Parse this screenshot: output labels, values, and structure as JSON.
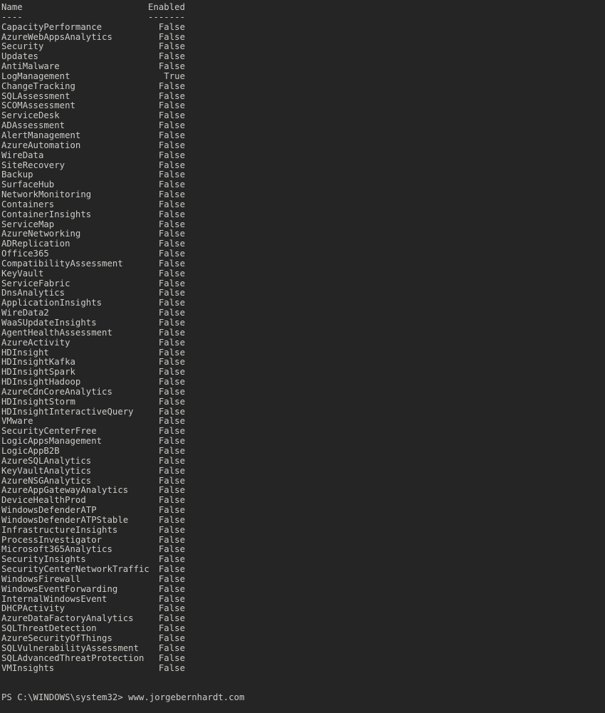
{
  "terminal": {
    "app": "Windows PowerShell",
    "background_color": "#252526",
    "text_color": "#ccccc7",
    "header": {
      "name_label": "Name",
      "enabled_label": "Enabled",
      "name_rule": "----",
      "enabled_rule": "-------"
    },
    "rows": [
      {
        "name": "CapacityPerformance",
        "enabled": "False"
      },
      {
        "name": "AzureWebAppsAnalytics",
        "enabled": "False"
      },
      {
        "name": "Security",
        "enabled": "False"
      },
      {
        "name": "Updates",
        "enabled": "False"
      },
      {
        "name": "AntiMalware",
        "enabled": "False"
      },
      {
        "name": "LogManagement",
        "enabled": "True"
      },
      {
        "name": "ChangeTracking",
        "enabled": "False"
      },
      {
        "name": "SQLAssessment",
        "enabled": "False"
      },
      {
        "name": "SCOMAssessment",
        "enabled": "False"
      },
      {
        "name": "ServiceDesk",
        "enabled": "False"
      },
      {
        "name": "ADAssessment",
        "enabled": "False"
      },
      {
        "name": "AlertManagement",
        "enabled": "False"
      },
      {
        "name": "AzureAutomation",
        "enabled": "False"
      },
      {
        "name": "WireData",
        "enabled": "False"
      },
      {
        "name": "SiteRecovery",
        "enabled": "False"
      },
      {
        "name": "Backup",
        "enabled": "False"
      },
      {
        "name": "SurfaceHub",
        "enabled": "False"
      },
      {
        "name": "NetworkMonitoring",
        "enabled": "False"
      },
      {
        "name": "Containers",
        "enabled": "False"
      },
      {
        "name": "ContainerInsights",
        "enabled": "False"
      },
      {
        "name": "ServiceMap",
        "enabled": "False"
      },
      {
        "name": "AzureNetworking",
        "enabled": "False"
      },
      {
        "name": "ADReplication",
        "enabled": "False"
      },
      {
        "name": "Office365",
        "enabled": "False"
      },
      {
        "name": "CompatibilityAssessment",
        "enabled": "False"
      },
      {
        "name": "KeyVault",
        "enabled": "False"
      },
      {
        "name": "ServiceFabric",
        "enabled": "False"
      },
      {
        "name": "DnsAnalytics",
        "enabled": "False"
      },
      {
        "name": "ApplicationInsights",
        "enabled": "False"
      },
      {
        "name": "WireData2",
        "enabled": "False"
      },
      {
        "name": "WaaSUpdateInsights",
        "enabled": "False"
      },
      {
        "name": "AgentHealthAssessment",
        "enabled": "False"
      },
      {
        "name": "AzureActivity",
        "enabled": "False"
      },
      {
        "name": "HDInsight",
        "enabled": "False"
      },
      {
        "name": "HDInsightKafka",
        "enabled": "False"
      },
      {
        "name": "HDInsightSpark",
        "enabled": "False"
      },
      {
        "name": "HDInsightHadoop",
        "enabled": "False"
      },
      {
        "name": "AzureCdnCoreAnalytics",
        "enabled": "False"
      },
      {
        "name": "HDInsightStorm",
        "enabled": "False"
      },
      {
        "name": "HDInsightInteractiveQuery",
        "enabled": "False"
      },
      {
        "name": "VMware",
        "enabled": "False"
      },
      {
        "name": "SecurityCenterFree",
        "enabled": "False"
      },
      {
        "name": "LogicAppsManagement",
        "enabled": "False"
      },
      {
        "name": "LogicAppB2B",
        "enabled": "False"
      },
      {
        "name": "AzureSQLAnalytics",
        "enabled": "False"
      },
      {
        "name": "KeyVaultAnalytics",
        "enabled": "False"
      },
      {
        "name": "AzureNSGAnalytics",
        "enabled": "False"
      },
      {
        "name": "AzureAppGatewayAnalytics",
        "enabled": "False"
      },
      {
        "name": "DeviceHealthProd",
        "enabled": "False"
      },
      {
        "name": "WindowsDefenderATP",
        "enabled": "False"
      },
      {
        "name": "WindowsDefenderATPStable",
        "enabled": "False"
      },
      {
        "name": "InfrastructureInsights",
        "enabled": "False"
      },
      {
        "name": "ProcessInvestigator",
        "enabled": "False"
      },
      {
        "name": "Microsoft365Analytics",
        "enabled": "False"
      },
      {
        "name": "SecurityInsights",
        "enabled": "False"
      },
      {
        "name": "SecurityCenterNetworkTraffic",
        "enabled": "False"
      },
      {
        "name": "WindowsFirewall",
        "enabled": "False"
      },
      {
        "name": "WindowsEventForwarding",
        "enabled": "False"
      },
      {
        "name": "InternalWindowsEvent",
        "enabled": "False"
      },
      {
        "name": "DHCPActivity",
        "enabled": "False"
      },
      {
        "name": "AzureDataFactoryAnalytics",
        "enabled": "False"
      },
      {
        "name": "SQLThreatDetection",
        "enabled": "False"
      },
      {
        "name": "AzureSecurityOfThings",
        "enabled": "False"
      },
      {
        "name": "SQLVulnerabilityAssessment",
        "enabled": "False"
      },
      {
        "name": "SQLAdvancedThreatProtection",
        "enabled": "False"
      },
      {
        "name": "VMInsights",
        "enabled": "False"
      }
    ],
    "prompt": {
      "path": "PS C:\\WINDOWS\\system32>",
      "command": " www.jorgebernhardt.com"
    }
  }
}
